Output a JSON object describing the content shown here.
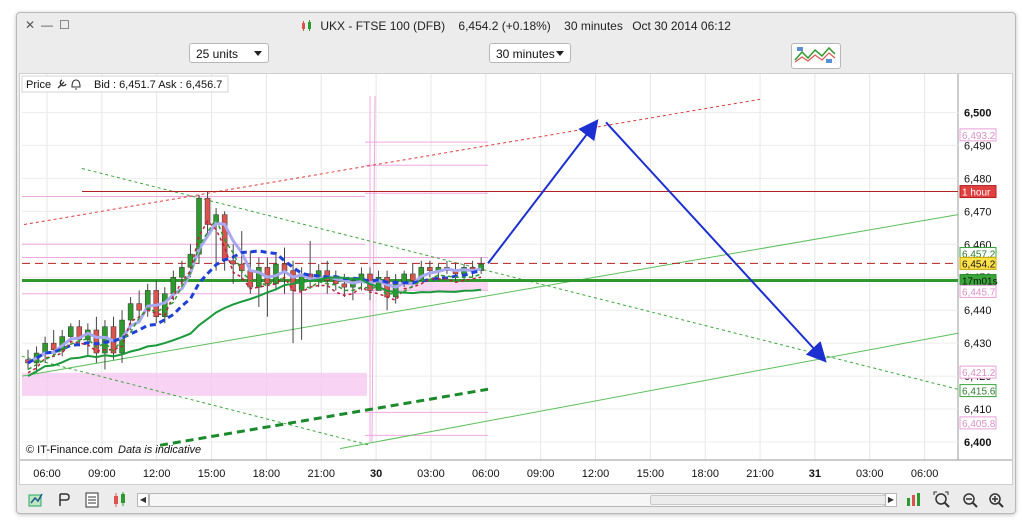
{
  "window": {
    "controls": {
      "close": "✕",
      "minimize": "—",
      "maximize": "☐"
    },
    "title": {
      "instrument": "UKX - FTSE 100 (DFB)",
      "price_change": "6,454.2 (+0.18%)",
      "timeframe": "30 minutes",
      "datetime": "Oct 30 2014 06:12"
    }
  },
  "toolbar": {
    "units_select": "25 units",
    "timeframe_select": "30 minutes"
  },
  "chart_header": {
    "price_label": "Price",
    "bid_ask": "Bid : 6,451.7 Ask : 6,456.7"
  },
  "footer": {
    "copyright": "© IT-Finance.com",
    "disclaimer": "Data is indicative"
  },
  "chart_data": {
    "type": "candlestick",
    "instrument": "UKX - FTSE 100 (DFB)",
    "timeframe": "30 minutes",
    "ylim": [
      6400,
      6505
    ],
    "y_ticks": [
      "6,500",
      "6,490",
      "6,480",
      "6,470",
      "6,460",
      "6,450",
      "6,440",
      "6,430",
      "6,420",
      "6,410",
      "6,400"
    ],
    "x_ticks": [
      "06:00",
      "09:00",
      "12:00",
      "15:00",
      "18:00",
      "21:00",
      "30",
      "03:00",
      "06:00",
      "09:00",
      "12:00",
      "15:00",
      "18:00",
      "21:00",
      "31",
      "03:00",
      "06:00"
    ],
    "price_tags": [
      {
        "label": "6,493.2",
        "value": 6493.2,
        "style": "pink"
      },
      {
        "label": "1 hour",
        "value": 6476,
        "style": "red"
      },
      {
        "label": "6,457.2",
        "value": 6457.2,
        "style": "green"
      },
      {
        "label": "6,454.2",
        "value": 6454.2,
        "style": "yellow"
      },
      {
        "label": "17m01s",
        "value": 6449,
        "style": "green-fill"
      },
      {
        "label": "6,445.7",
        "value": 6445.7,
        "style": "pink"
      },
      {
        "label": "6,421.2",
        "value": 6421.2,
        "style": "pink"
      },
      {
        "label": "6,415.6",
        "value": 6415.6,
        "style": "green"
      },
      {
        "label": "6,405.8",
        "value": 6405.8,
        "style": "pink"
      }
    ],
    "candles": [
      [
        6425,
        6428,
        6422,
        6424
      ],
      [
        6424,
        6429,
        6421,
        6427
      ],
      [
        6427,
        6432,
        6424,
        6430
      ],
      [
        6430,
        6434,
        6426,
        6428
      ],
      [
        6428,
        6434,
        6426,
        6432
      ],
      [
        6432,
        6436,
        6430,
        6435
      ],
      [
        6435,
        6437,
        6429,
        6431
      ],
      [
        6431,
        6436,
        6426,
        6434
      ],
      [
        6434,
        6438,
        6424,
        6427
      ],
      [
        6427,
        6437,
        6422,
        6435
      ],
      [
        6435,
        6438,
        6425,
        6427
      ],
      [
        6427,
        6440,
        6424,
        6437
      ],
      [
        6437,
        6444,
        6434,
        6442
      ],
      [
        6442,
        6446,
        6436,
        6440
      ],
      [
        6440,
        6448,
        6438,
        6446
      ],
      [
        6446,
        6449,
        6436,
        6438
      ],
      [
        6438,
        6447,
        6436,
        6445
      ],
      [
        6445,
        6452,
        6443,
        6450
      ],
      [
        6450,
        6455,
        6447,
        6453
      ],
      [
        6453,
        6460,
        6450,
        6457
      ],
      [
        6457,
        6475,
        6454,
        6474
      ],
      [
        6474,
        6476,
        6462,
        6466
      ],
      [
        6466,
        6471,
        6452,
        6469
      ],
      [
        6469,
        6470,
        6452,
        6455
      ],
      [
        6455,
        6460,
        6448,
        6454
      ],
      [
        6454,
        6464,
        6449,
        6452
      ],
      [
        6452,
        6458,
        6445,
        6447
      ],
      [
        6447,
        6456,
        6441,
        6453
      ],
      [
        6453,
        6456,
        6438,
        6448
      ],
      [
        6448,
        6457,
        6446,
        6454
      ],
      [
        6454,
        6459,
        6445,
        6452
      ],
      [
        6452,
        6455,
        6430,
        6446
      ],
      [
        6446,
        6453,
        6431,
        6451
      ],
      [
        6451,
        6461,
        6447,
        6449
      ],
      [
        6449,
        6454,
        6447,
        6452
      ],
      [
        6452,
        6455,
        6445,
        6449
      ],
      [
        6449,
        6452,
        6446,
        6448
      ],
      [
        6448,
        6451,
        6444,
        6447
      ],
      [
        6447,
        6450,
        6443,
        6449
      ],
      [
        6449,
        6453,
        6446,
        6451
      ],
      [
        6451,
        6453,
        6443,
        6446
      ],
      [
        6446,
        6452,
        6446,
        6450
      ],
      [
        6450,
        6452,
        6440,
        6444
      ],
      [
        6444,
        6451,
        6442,
        6448
      ],
      [
        6448,
        6452,
        6447,
        6451
      ],
      [
        6451,
        6454,
        6448,
        6449
      ],
      [
        6449,
        6455,
        6449,
        6453
      ],
      [
        6453,
        6455,
        6450,
        6452
      ],
      [
        6452,
        6454,
        6449,
        6453
      ],
      [
        6453,
        6455,
        6451,
        6452
      ],
      [
        6452,
        6454,
        6449,
        6451
      ],
      [
        6451,
        6454,
        6449,
        6453
      ],
      [
        6453,
        6455,
        6450,
        6452
      ],
      [
        6452,
        6456,
        6451,
        6454
      ]
    ],
    "forecast_path": [
      [
        6454.2,
        6497,
        6425
      ]
    ],
    "horizontal_lines": [
      {
        "value": 6476,
        "style": "solid-darkred"
      },
      {
        "value": 6454.2,
        "style": "dashed-darkred"
      },
      {
        "value": 6449,
        "style": "solid-green-thick"
      }
    ]
  },
  "colors": {
    "bull": "#2e9a2e",
    "bear": "#d9534f",
    "forecast": "#1c2fd0",
    "ma_blue": "#1e3fd8",
    "ma_lavender": "#a8a8f0",
    "ma_green": "#1a9a3a",
    "envelope_pink": "#f8c8f0"
  },
  "icons": [
    "chart-settings-icon",
    "drawing-tools-icon",
    "calculator-icon",
    "candlestick-icon",
    "indicators-icon",
    "zoom-fit-icon",
    "zoom-out-icon",
    "zoom-in-icon",
    "wrench-icon",
    "bell-icon"
  ]
}
